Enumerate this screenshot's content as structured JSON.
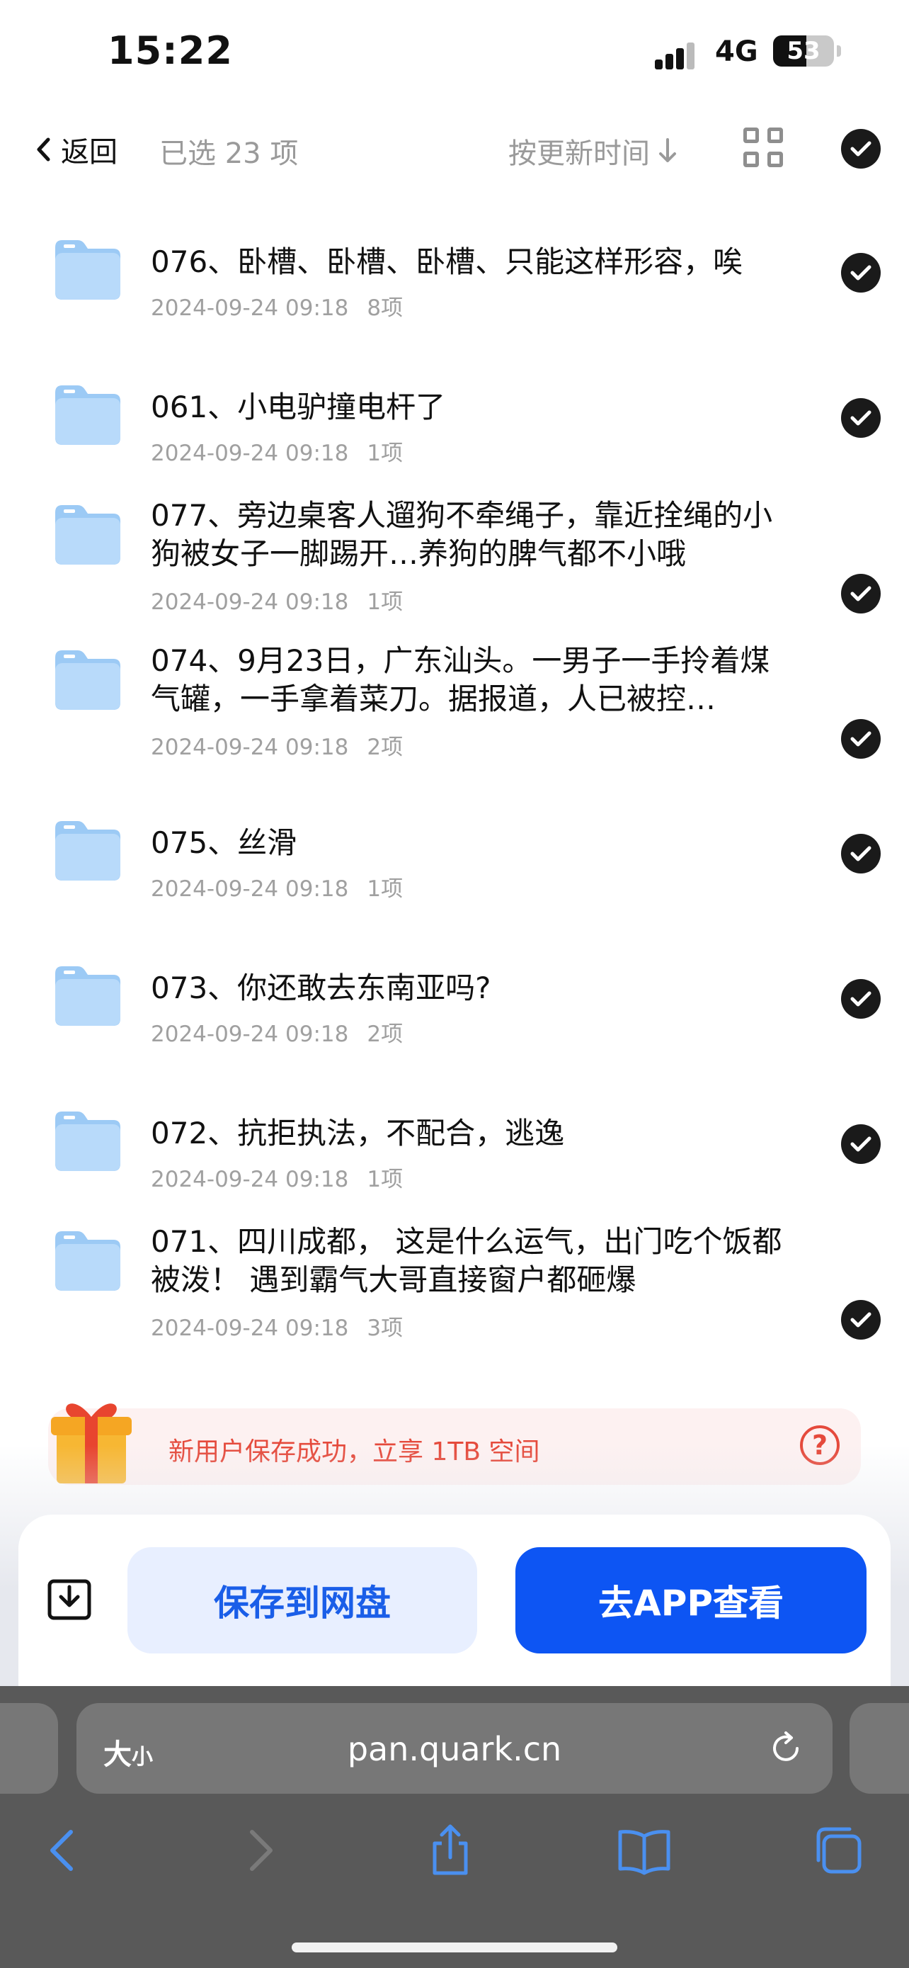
{
  "status_bar": {
    "time": "15:22",
    "network": "4G",
    "battery": "53"
  },
  "topbar": {
    "back_label": "返回",
    "selected_label": "已选 23 项",
    "sort_label": "按更新时间",
    "sort_arrow": "↓"
  },
  "items": [
    {
      "title": "076、卧槽、卧槽、卧槽、只能这样形容，唉",
      "date": "2024-09-24 09:18",
      "count": "8项"
    },
    {
      "title": "061、小电驴撞电杆了",
      "date": "2024-09-24 09:18",
      "count": "1项"
    },
    {
      "title": "077、旁边桌客人遛狗不牵绳子，靠近拴绳的小狗被女子一脚踢开…养狗的脾气都不小哦",
      "date": "2024-09-24 09:18",
      "count": "1项"
    },
    {
      "title": "074、9月23日，广东汕头。一男子一手拎着煤气罐，一手拿着菜刀。据报道，人已被控…",
      "date": "2024-09-24 09:18",
      "count": "2项"
    },
    {
      "title": "075、丝滑",
      "date": "2024-09-24 09:18",
      "count": "1项"
    },
    {
      "title": "073、你还敢去东南亚吗?",
      "date": "2024-09-24 09:18",
      "count": "2项"
    },
    {
      "title": "072、抗拒执法，不配合，逃逸",
      "date": "2024-09-24 09:18",
      "count": "1项"
    },
    {
      "title": "071、四川成都， 这是什么运气，出门吃个饭都被泼！ 遇到霸气大哥直接窗户都砸爆",
      "date": "2024-09-24 09:18",
      "count": "3项"
    }
  ],
  "promo": {
    "text": "新用户保存成功，立享 1TB 空间",
    "help_symbol": "?"
  },
  "actions": {
    "save_label": "保存到网盘",
    "app_label": "去APP查看"
  },
  "safari": {
    "aa_big": "大",
    "aa_small": "小",
    "url": "pan.quark.cn"
  },
  "colors": {
    "accent": "#0d55f3",
    "promo_text": "#e54a3c",
    "folder": "#9ccaf5"
  },
  "icons": [
    "back-chevron-icon",
    "sort-arrow-icon",
    "grid-view-icon",
    "check-icon",
    "folder-icon",
    "gift-icon",
    "help-icon",
    "download-icon",
    "reload-icon",
    "safari-back-icon",
    "safari-forward-icon",
    "share-icon",
    "bookmarks-icon",
    "tabs-icon"
  ]
}
